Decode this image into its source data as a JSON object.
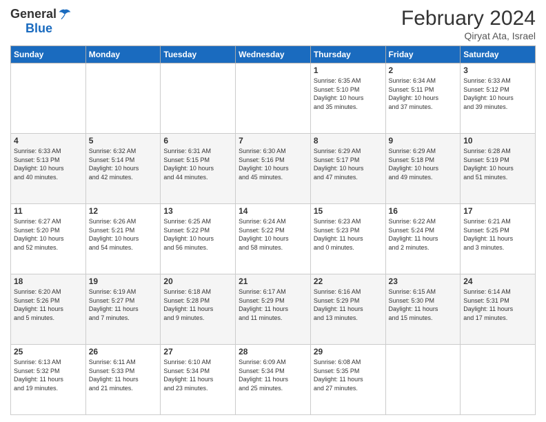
{
  "header": {
    "logo_general": "General",
    "logo_blue": "Blue",
    "month_title": "February 2024",
    "subtitle": "Qiryat Ata, Israel"
  },
  "days_of_week": [
    "Sunday",
    "Monday",
    "Tuesday",
    "Wednesday",
    "Thursday",
    "Friday",
    "Saturday"
  ],
  "weeks": [
    {
      "days": [
        {
          "num": "",
          "info": ""
        },
        {
          "num": "",
          "info": ""
        },
        {
          "num": "",
          "info": ""
        },
        {
          "num": "",
          "info": ""
        },
        {
          "num": "1",
          "info": "Sunrise: 6:35 AM\nSunset: 5:10 PM\nDaylight: 10 hours\nand 35 minutes."
        },
        {
          "num": "2",
          "info": "Sunrise: 6:34 AM\nSunset: 5:11 PM\nDaylight: 10 hours\nand 37 minutes."
        },
        {
          "num": "3",
          "info": "Sunrise: 6:33 AM\nSunset: 5:12 PM\nDaylight: 10 hours\nand 39 minutes."
        }
      ]
    },
    {
      "days": [
        {
          "num": "4",
          "info": "Sunrise: 6:33 AM\nSunset: 5:13 PM\nDaylight: 10 hours\nand 40 minutes."
        },
        {
          "num": "5",
          "info": "Sunrise: 6:32 AM\nSunset: 5:14 PM\nDaylight: 10 hours\nand 42 minutes."
        },
        {
          "num": "6",
          "info": "Sunrise: 6:31 AM\nSunset: 5:15 PM\nDaylight: 10 hours\nand 44 minutes."
        },
        {
          "num": "7",
          "info": "Sunrise: 6:30 AM\nSunset: 5:16 PM\nDaylight: 10 hours\nand 45 minutes."
        },
        {
          "num": "8",
          "info": "Sunrise: 6:29 AM\nSunset: 5:17 PM\nDaylight: 10 hours\nand 47 minutes."
        },
        {
          "num": "9",
          "info": "Sunrise: 6:29 AM\nSunset: 5:18 PM\nDaylight: 10 hours\nand 49 minutes."
        },
        {
          "num": "10",
          "info": "Sunrise: 6:28 AM\nSunset: 5:19 PM\nDaylight: 10 hours\nand 51 minutes."
        }
      ]
    },
    {
      "days": [
        {
          "num": "11",
          "info": "Sunrise: 6:27 AM\nSunset: 5:20 PM\nDaylight: 10 hours\nand 52 minutes."
        },
        {
          "num": "12",
          "info": "Sunrise: 6:26 AM\nSunset: 5:21 PM\nDaylight: 10 hours\nand 54 minutes."
        },
        {
          "num": "13",
          "info": "Sunrise: 6:25 AM\nSunset: 5:22 PM\nDaylight: 10 hours\nand 56 minutes."
        },
        {
          "num": "14",
          "info": "Sunrise: 6:24 AM\nSunset: 5:22 PM\nDaylight: 10 hours\nand 58 minutes."
        },
        {
          "num": "15",
          "info": "Sunrise: 6:23 AM\nSunset: 5:23 PM\nDaylight: 11 hours\nand 0 minutes."
        },
        {
          "num": "16",
          "info": "Sunrise: 6:22 AM\nSunset: 5:24 PM\nDaylight: 11 hours\nand 2 minutes."
        },
        {
          "num": "17",
          "info": "Sunrise: 6:21 AM\nSunset: 5:25 PM\nDaylight: 11 hours\nand 3 minutes."
        }
      ]
    },
    {
      "days": [
        {
          "num": "18",
          "info": "Sunrise: 6:20 AM\nSunset: 5:26 PM\nDaylight: 11 hours\nand 5 minutes."
        },
        {
          "num": "19",
          "info": "Sunrise: 6:19 AM\nSunset: 5:27 PM\nDaylight: 11 hours\nand 7 minutes."
        },
        {
          "num": "20",
          "info": "Sunrise: 6:18 AM\nSunset: 5:28 PM\nDaylight: 11 hours\nand 9 minutes."
        },
        {
          "num": "21",
          "info": "Sunrise: 6:17 AM\nSunset: 5:29 PM\nDaylight: 11 hours\nand 11 minutes."
        },
        {
          "num": "22",
          "info": "Sunrise: 6:16 AM\nSunset: 5:29 PM\nDaylight: 11 hours\nand 13 minutes."
        },
        {
          "num": "23",
          "info": "Sunrise: 6:15 AM\nSunset: 5:30 PM\nDaylight: 11 hours\nand 15 minutes."
        },
        {
          "num": "24",
          "info": "Sunrise: 6:14 AM\nSunset: 5:31 PM\nDaylight: 11 hours\nand 17 minutes."
        }
      ]
    },
    {
      "days": [
        {
          "num": "25",
          "info": "Sunrise: 6:13 AM\nSunset: 5:32 PM\nDaylight: 11 hours\nand 19 minutes."
        },
        {
          "num": "26",
          "info": "Sunrise: 6:11 AM\nSunset: 5:33 PM\nDaylight: 11 hours\nand 21 minutes."
        },
        {
          "num": "27",
          "info": "Sunrise: 6:10 AM\nSunset: 5:34 PM\nDaylight: 11 hours\nand 23 minutes."
        },
        {
          "num": "28",
          "info": "Sunrise: 6:09 AM\nSunset: 5:34 PM\nDaylight: 11 hours\nand 25 minutes."
        },
        {
          "num": "29",
          "info": "Sunrise: 6:08 AM\nSunset: 5:35 PM\nDaylight: 11 hours\nand 27 minutes."
        },
        {
          "num": "",
          "info": ""
        },
        {
          "num": "",
          "info": ""
        }
      ]
    }
  ]
}
